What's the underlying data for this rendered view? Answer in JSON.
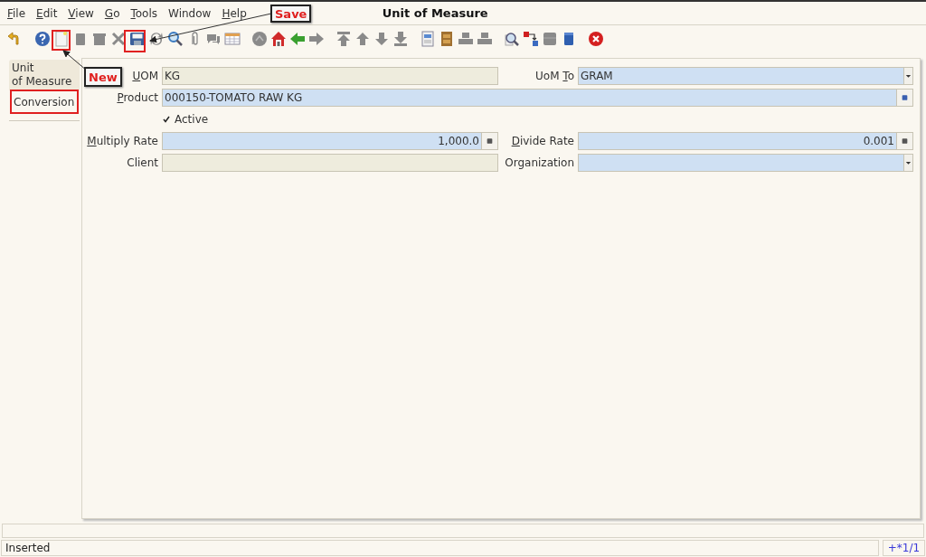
{
  "menu": [
    {
      "label": "File",
      "underlined": true
    },
    {
      "label": "Edit",
      "underlined": true
    },
    {
      "label": "View",
      "underlined": true
    },
    {
      "label": "Go",
      "underlined": true
    },
    {
      "label": "Tools",
      "underlined": true
    },
    {
      "label": "Window",
      "underlined": false
    },
    {
      "label": "Help",
      "underlined": true
    }
  ],
  "window": {
    "title": "Unit of Measure"
  },
  "tabs": [
    {
      "label": "Unit\nof Measure",
      "selected": false
    },
    {
      "label": "Conversion",
      "selected": true
    }
  ],
  "form": {
    "uom": {
      "label": "UOM",
      "value": "KG",
      "readonly": true
    },
    "uom_to": {
      "label_before": "UoM ",
      "label_key": "T",
      "label_after": "o",
      "value": "GRAM",
      "readonly": false
    },
    "product": {
      "label": "Product",
      "value": "000150-TOMATO RAW KG",
      "readonly": false
    },
    "active": {
      "label": "Active",
      "checked": true
    },
    "multiply_rate": {
      "label": "Multiply Rate",
      "value": "1,000.0",
      "readonly": false
    },
    "divide_rate": {
      "label": "Divide Rate",
      "value": "0.001",
      "readonly": false
    },
    "client": {
      "label": "Client",
      "readonly": true
    },
    "organization": {
      "label": "Organization",
      "readonly": false
    }
  },
  "annotations": [
    {
      "label": "Save"
    },
    {
      "label": "New"
    }
  ],
  "status_bar": {
    "message": "Inserted",
    "record": "+*1/1"
  }
}
